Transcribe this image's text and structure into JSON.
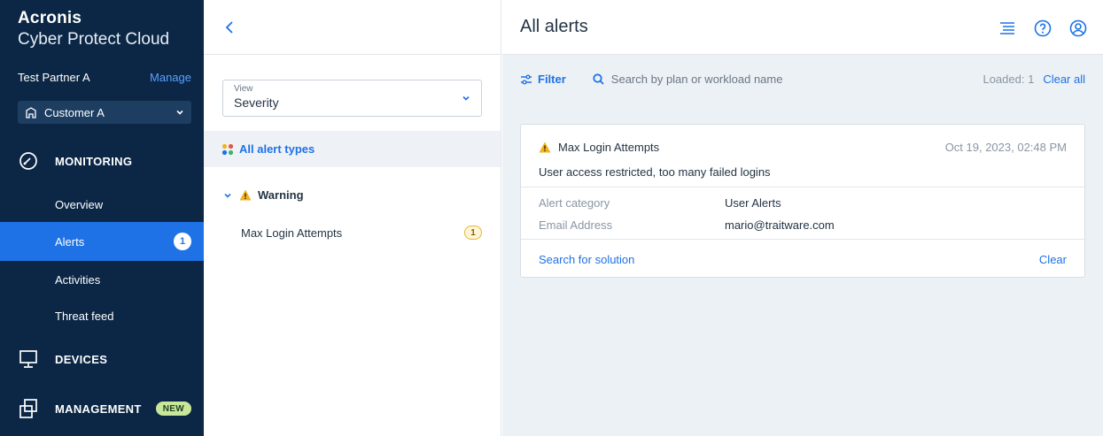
{
  "brand": {
    "line1": "Acronis",
    "line2": "Cyber Protect Cloud"
  },
  "partner": {
    "name": "Test Partner A",
    "manage": "Manage"
  },
  "customer": {
    "label": "Customer A",
    "icon": "building-icon"
  },
  "nav": {
    "monitoring": "MONITORING",
    "items": [
      {
        "label": "Overview"
      },
      {
        "label": "Alerts",
        "badge": "1"
      },
      {
        "label": "Activities"
      },
      {
        "label": "Threat feed"
      }
    ],
    "devices": "DEVICES",
    "management": "MANAGEMENT",
    "new_badge": "NEW"
  },
  "middle": {
    "view_label": "View",
    "view_value": "Severity",
    "all_types": "All alert types",
    "warning": "Warning",
    "alert_item": "Max Login Attempts",
    "alert_count": "1"
  },
  "main": {
    "title": "All alerts",
    "filter": "Filter",
    "search_placeholder": "Search by plan or workload name",
    "loaded": "Loaded: 1",
    "clear_all": "Clear all"
  },
  "card": {
    "title": "Max Login Attempts",
    "time": "Oct 19, 2023, 02:48 PM",
    "description": "User access restricted, too many failed logins",
    "fields": [
      {
        "key": "Alert category",
        "value": "User Alerts"
      },
      {
        "key": "Email Address",
        "value": "mario@traitware.com"
      }
    ],
    "search_solution": "Search for solution",
    "clear": "Clear"
  },
  "colors": {
    "sidebar": "#0b2745",
    "accent": "#1e72e6",
    "warning": "#f2b21c"
  }
}
